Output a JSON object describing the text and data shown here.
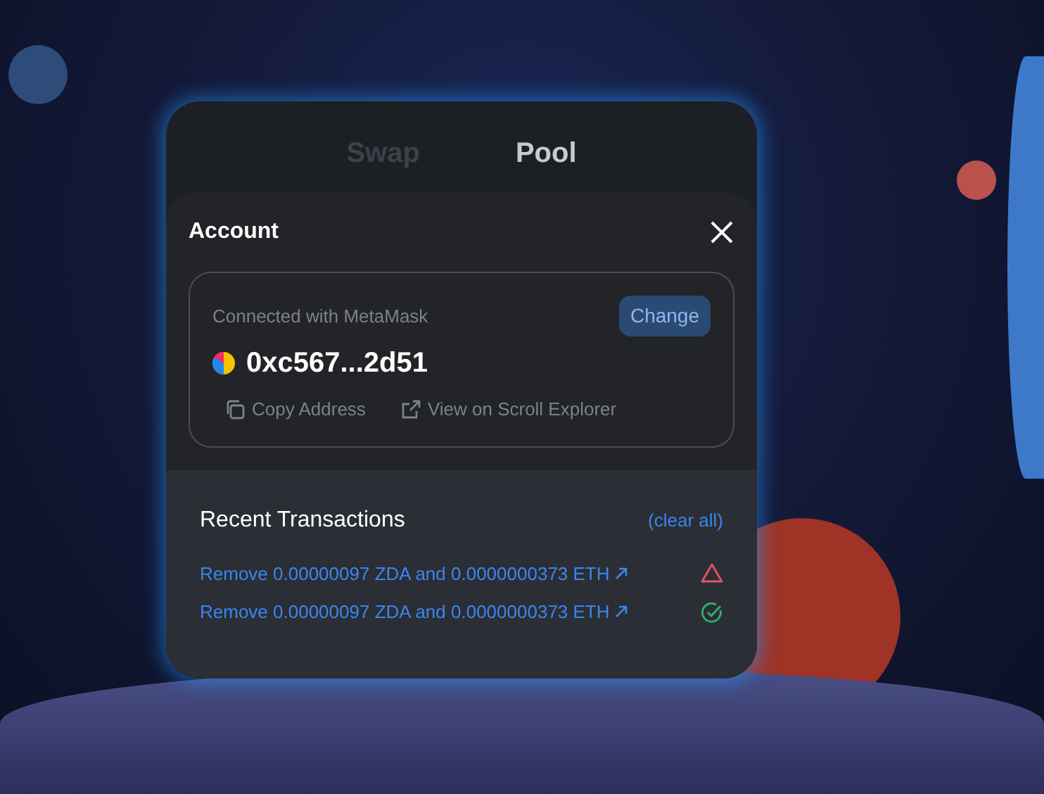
{
  "tabs": [
    {
      "label": "Swap",
      "selected": false
    },
    {
      "label": "Pool",
      "selected": true
    }
  ],
  "account": {
    "title": "Account",
    "connected_label": "Connected with MetaMask",
    "change_button": "Change",
    "address": "0xc567...2d51",
    "actions": [
      "Copy Address",
      "View on Scroll Explorer"
    ]
  },
  "recent_transactions": {
    "title": "Recent Transactions",
    "clear_link": "(clear all)",
    "items": [
      {
        "text": "Remove 0.00000097 ZDA and 0.0000000373 ETH",
        "kind": "failed"
      },
      {
        "text": "Remove 0.00000097 ZDA and 0.0000000373 ETH",
        "kind": "success"
      }
    ]
  }
}
